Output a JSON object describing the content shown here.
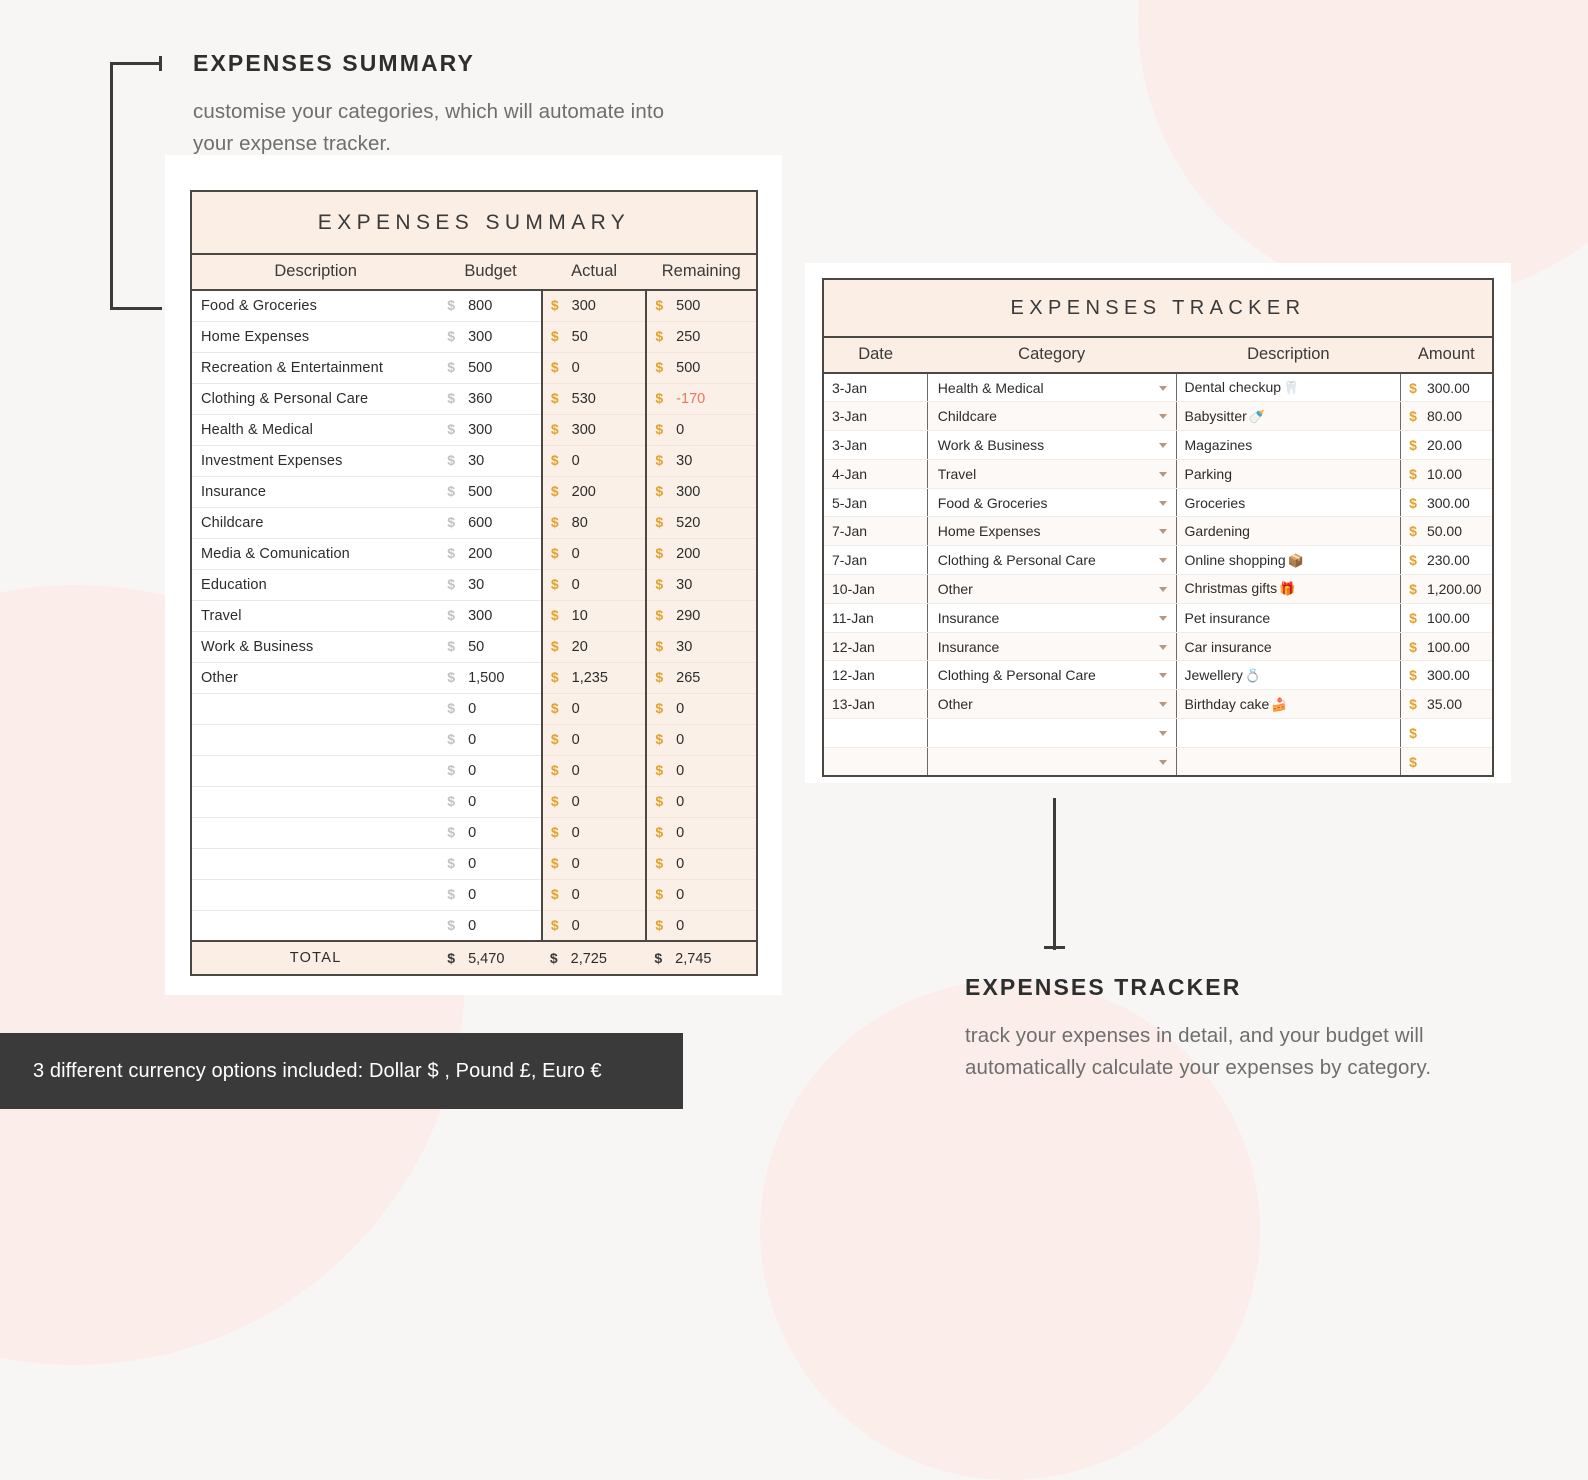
{
  "callouts": {
    "summary": {
      "title": "EXPENSES SUMMARY",
      "body": "customise your categories, which will automate into your expense tracker."
    },
    "tracker": {
      "title": "EXPENSES TRACKER",
      "body": "track your expenses in detail, and your budget will automatically calculate your expenses by category."
    }
  },
  "banner": {
    "text": "3 different currency options included: Dollar $ , Pound £, Euro €"
  },
  "summary_sheet": {
    "title": "EXPENSES SUMMARY",
    "columns": [
      "Description",
      "Budget",
      "Actual",
      "Remaining"
    ],
    "currency_symbol": "$",
    "rows": [
      {
        "description": "Food & Groceries",
        "budget": "800",
        "actual": "300",
        "remaining": "500",
        "negative": false
      },
      {
        "description": "Home Expenses",
        "budget": "300",
        "actual": "50",
        "remaining": "250",
        "negative": false
      },
      {
        "description": "Recreation & Entertainment",
        "budget": "500",
        "actual": "0",
        "remaining": "500",
        "negative": false
      },
      {
        "description": "Clothing & Personal Care",
        "budget": "360",
        "actual": "530",
        "remaining": "-170",
        "negative": true
      },
      {
        "description": "Health & Medical",
        "budget": "300",
        "actual": "300",
        "remaining": "0",
        "negative": false
      },
      {
        "description": "Investment Expenses",
        "budget": "30",
        "actual": "0",
        "remaining": "30",
        "negative": false
      },
      {
        "description": "Insurance",
        "budget": "500",
        "actual": "200",
        "remaining": "300",
        "negative": false
      },
      {
        "description": "Childcare",
        "budget": "600",
        "actual": "80",
        "remaining": "520",
        "negative": false
      },
      {
        "description": "Media & Comunication",
        "budget": "200",
        "actual": "0",
        "remaining": "200",
        "negative": false
      },
      {
        "description": "Education",
        "budget": "30",
        "actual": "0",
        "remaining": "30",
        "negative": false
      },
      {
        "description": "Travel",
        "budget": "300",
        "actual": "10",
        "remaining": "290",
        "negative": false
      },
      {
        "description": "Work & Business",
        "budget": "50",
        "actual": "20",
        "remaining": "30",
        "negative": false
      },
      {
        "description": "Other",
        "budget": "1,500",
        "actual": "1,235",
        "remaining": "265",
        "negative": false
      },
      {
        "description": "",
        "budget": "0",
        "actual": "0",
        "remaining": "0",
        "negative": false
      },
      {
        "description": "",
        "budget": "0",
        "actual": "0",
        "remaining": "0",
        "negative": false
      },
      {
        "description": "",
        "budget": "0",
        "actual": "0",
        "remaining": "0",
        "negative": false
      },
      {
        "description": "",
        "budget": "0",
        "actual": "0",
        "remaining": "0",
        "negative": false
      },
      {
        "description": "",
        "budget": "0",
        "actual": "0",
        "remaining": "0",
        "negative": false
      },
      {
        "description": "",
        "budget": "0",
        "actual": "0",
        "remaining": "0",
        "negative": false
      },
      {
        "description": "",
        "budget": "0",
        "actual": "0",
        "remaining": "0",
        "negative": false
      },
      {
        "description": "",
        "budget": "0",
        "actual": "0",
        "remaining": "0",
        "negative": false
      }
    ],
    "total": {
      "label": "TOTAL",
      "budget": "5,470",
      "actual": "2,725",
      "remaining": "2,745"
    }
  },
  "tracker_sheet": {
    "title": "EXPENSES TRACKER",
    "columns": [
      "Date",
      "Category",
      "Description",
      "Amount"
    ],
    "currency_symbol": "$",
    "rows": [
      {
        "date": "3-Jan",
        "category": "Health & Medical",
        "description": "Dental checkup",
        "emoji": "🦷",
        "amount": "300.00"
      },
      {
        "date": "3-Jan",
        "category": "Childcare",
        "description": "Babysitter",
        "emoji": "🍼",
        "amount": "80.00"
      },
      {
        "date": "3-Jan",
        "category": "Work & Business",
        "description": "Magazines",
        "emoji": "",
        "amount": "20.00"
      },
      {
        "date": "4-Jan",
        "category": "Travel",
        "description": "Parking",
        "emoji": "",
        "amount": "10.00"
      },
      {
        "date": "5-Jan",
        "category": "Food & Groceries",
        "description": "Groceries",
        "emoji": "",
        "amount": "300.00"
      },
      {
        "date": "7-Jan",
        "category": "Home Expenses",
        "description": "Gardening",
        "emoji": "",
        "amount": "50.00"
      },
      {
        "date": "7-Jan",
        "category": "Clothing & Personal Care",
        "description": "Online shopping",
        "emoji": "📦",
        "amount": "230.00"
      },
      {
        "date": "10-Jan",
        "category": "Other",
        "description": "Christmas gifts",
        "emoji": "🎁",
        "amount": "1,200.00"
      },
      {
        "date": "11-Jan",
        "category": "Insurance",
        "description": "Pet insurance",
        "emoji": "",
        "amount": "100.00"
      },
      {
        "date": "12-Jan",
        "category": "Insurance",
        "description": "Car insurance",
        "emoji": "",
        "amount": "100.00"
      },
      {
        "date": "12-Jan",
        "category": "Clothing & Personal Care",
        "description": "Jewellery",
        "emoji": "💍",
        "amount": "300.00"
      },
      {
        "date": "13-Jan",
        "category": "Other",
        "description": "Birthday cake",
        "emoji": "🍰",
        "amount": "35.00"
      },
      {
        "date": "",
        "category": "",
        "description": "",
        "emoji": "",
        "amount": ""
      },
      {
        "date": "",
        "category": "",
        "description": "",
        "emoji": "",
        "amount": ""
      }
    ]
  },
  "colors": {
    "page_bg": "#f7f6f4",
    "blob_pink": "#fbeeea",
    "header_peach": "#faeee5",
    "cell_tint": "#fbf0e8",
    "gold": "#e0a32e",
    "negative_red": "#e8775e",
    "ink": "#3a3a3a",
    "banner_bg": "#3a3a3a"
  }
}
